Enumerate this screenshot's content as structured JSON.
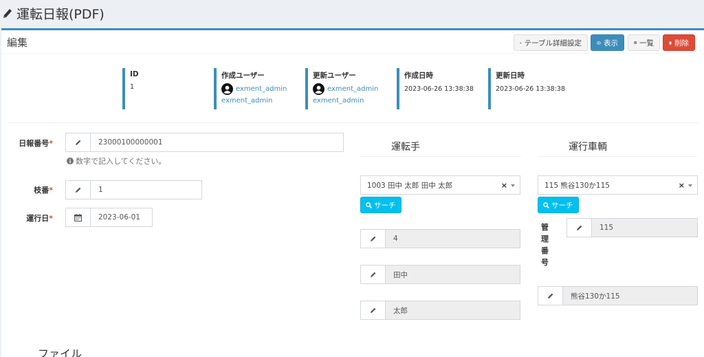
{
  "header": {
    "title": "運転日報(PDF)"
  },
  "box": {
    "title": "編集"
  },
  "toolbar": {
    "settings_label": "テーブル詳細設定",
    "view_label": "表示",
    "list_label": "一覧",
    "delete_label": "削除"
  },
  "meta": [
    {
      "label": "ID",
      "value": "1"
    },
    {
      "label": "作成ユーザー",
      "user": "exment_admin",
      "user2": "exment_admin"
    },
    {
      "label": "更新ユーザー",
      "user": "exment_admin",
      "user2": "exment_admin"
    },
    {
      "label": "作成日時",
      "value": "2023-06-26 13:38:38"
    },
    {
      "label": "更新日時",
      "value": "2023-06-26 13:38:38"
    }
  ],
  "form": {
    "report_number": {
      "label": "日報番号",
      "value": "23000100000001",
      "help": "数字で記入してください。"
    },
    "branch": {
      "label": "枝番",
      "value": "1"
    },
    "date": {
      "label": "運行日",
      "value": "2023-06-01"
    },
    "required_mark": "*"
  },
  "driver": {
    "title": "運転手",
    "selected": "1003 田中 太郎 田中 太郎",
    "clear": "×",
    "search_label": "サーチ",
    "fields": [
      "4",
      "田中",
      "太郎"
    ]
  },
  "vehicle": {
    "title": "運行車輌",
    "selected": "115 熊谷130か115",
    "clear": "×",
    "search_label": "サーチ",
    "mgmt_label_chars": [
      "管",
      "理",
      "番",
      "号"
    ],
    "mgmt_number": "115",
    "plate": "熊谷130か115"
  },
  "file": {
    "title": "ファイル"
  }
}
